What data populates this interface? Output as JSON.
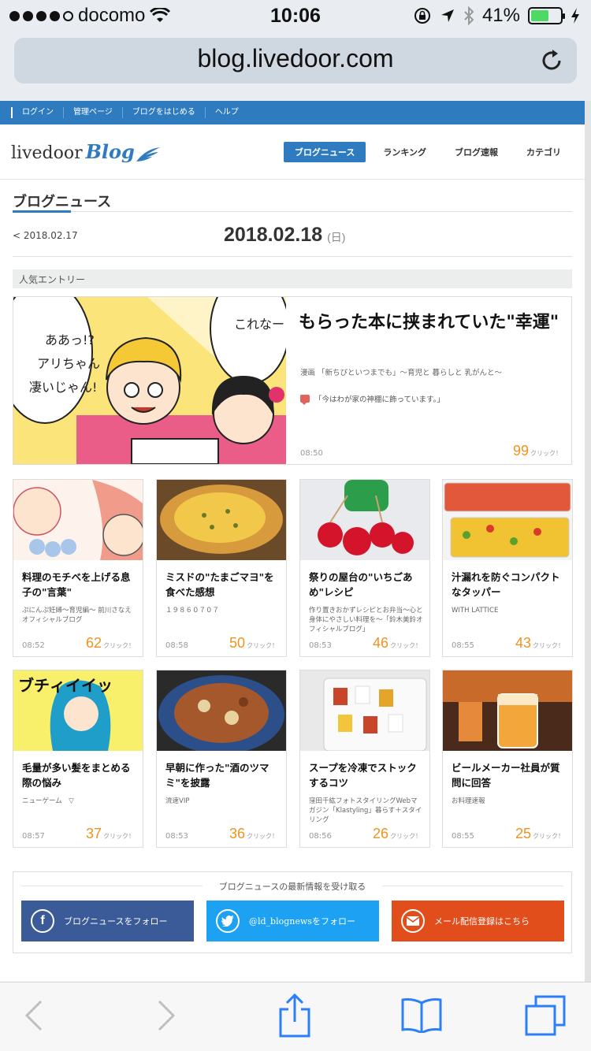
{
  "status_bar": {
    "carrier": "docomo",
    "time": "10:06",
    "battery": "41%",
    "battery_level": 0.41,
    "icons": [
      "signal-dots",
      "wifi-icon",
      "orientation-lock-icon",
      "location-icon",
      "bluetooth-icon",
      "battery-icon",
      "charging-icon"
    ]
  },
  "browser": {
    "url": "blog.livedoor.com"
  },
  "topnav": {
    "items": [
      "ログイン",
      "管理ページ",
      "ブログをはじめる",
      "ヘルプ"
    ]
  },
  "header": {
    "logo_text": "livedoor",
    "logo_blog": "Blog",
    "nav": [
      "ブログニュース",
      "ランキング",
      "ブログ速報",
      "カテゴリ"
    ],
    "active_nav": "ブログニュース",
    "accent": "#2f7bc0"
  },
  "section": {
    "title": "ブログニュース"
  },
  "date": {
    "prev": "< 2018.02.17",
    "current": "2018.02.18",
    "weekday": "(日)"
  },
  "popular": {
    "heading": "人気エントリー",
    "featured": {
      "title": "もらった本に挟まれていた\"幸運\"",
      "source": "漫画 「新ちびといつまでも」～育児と 暮らしと 乳がんと～",
      "comment": "「今はわが家の神棚に飾っています。」",
      "time": "08:50",
      "clicks": "99",
      "click_label": "クリック！"
    },
    "cards": [
      {
        "title": "料理のモチベを上げる息子の\"言葉\"",
        "source": "ぷにんぷ妊婦～育児編～ 前川さなえオフィシャルブログ",
        "time": "08:52",
        "clicks": "62",
        "click_label": "クリック！"
      },
      {
        "title": "ミスドの\"たまごマヨ\"を食べた感想",
        "source": "１９８６０７０７",
        "time": "08:58",
        "clicks": "50",
        "click_label": "クリック！"
      },
      {
        "title": "祭りの屋台の\"いちごあめ\"レシピ",
        "source": "作り置きおかずレシピとお弁当～心と身体にやさしい料理を～「鈴木美鈴オフィシャルブログ」",
        "time": "08:53",
        "clicks": "46",
        "click_label": "クリック！"
      },
      {
        "title": "汁漏れを防ぐコンパクトなタッパー",
        "source": "WITH LATTICE",
        "time": "08:55",
        "clicks": "43",
        "click_label": "クリック！"
      },
      {
        "title": "毛量が多い髪をまとめる際の悩み",
        "source": "ニューゲーム　▽",
        "time": "08:57",
        "clicks": "37",
        "click_label": "クリック！"
      },
      {
        "title": "早朝に作った\"酒のツマミ\"を披露",
        "source": "流速VIP",
        "time": "08:53",
        "clicks": "36",
        "click_label": "クリック！"
      },
      {
        "title": "スープを冷凍でストックするコツ",
        "source": "窪田千紘フォトスタイリングWebマガジン「Klastyling」暮らす＋スタイリング",
        "time": "08:56",
        "clicks": "26",
        "click_label": "クリック！"
      },
      {
        "title": "ビールメーカー社員が質問に回答",
        "source": "お料理速報",
        "time": "08:55",
        "clicks": "25",
        "click_label": "クリック！"
      }
    ]
  },
  "follow": {
    "heading": "ブログニュースの最新情報を受け取る",
    "facebook": "ブログニュースをフォロー",
    "twitter": "@ld_blognewsをフォロー",
    "mail": "メール配信登録はこちら",
    "colors": {
      "facebook": "#3a5a98",
      "twitter": "#1da1f2",
      "mail": "#e14d1b"
    }
  },
  "toolbar": {
    "icons": [
      "back-icon",
      "forward-icon",
      "share-icon",
      "bookmarks-icon",
      "tabs-icon"
    ]
  }
}
